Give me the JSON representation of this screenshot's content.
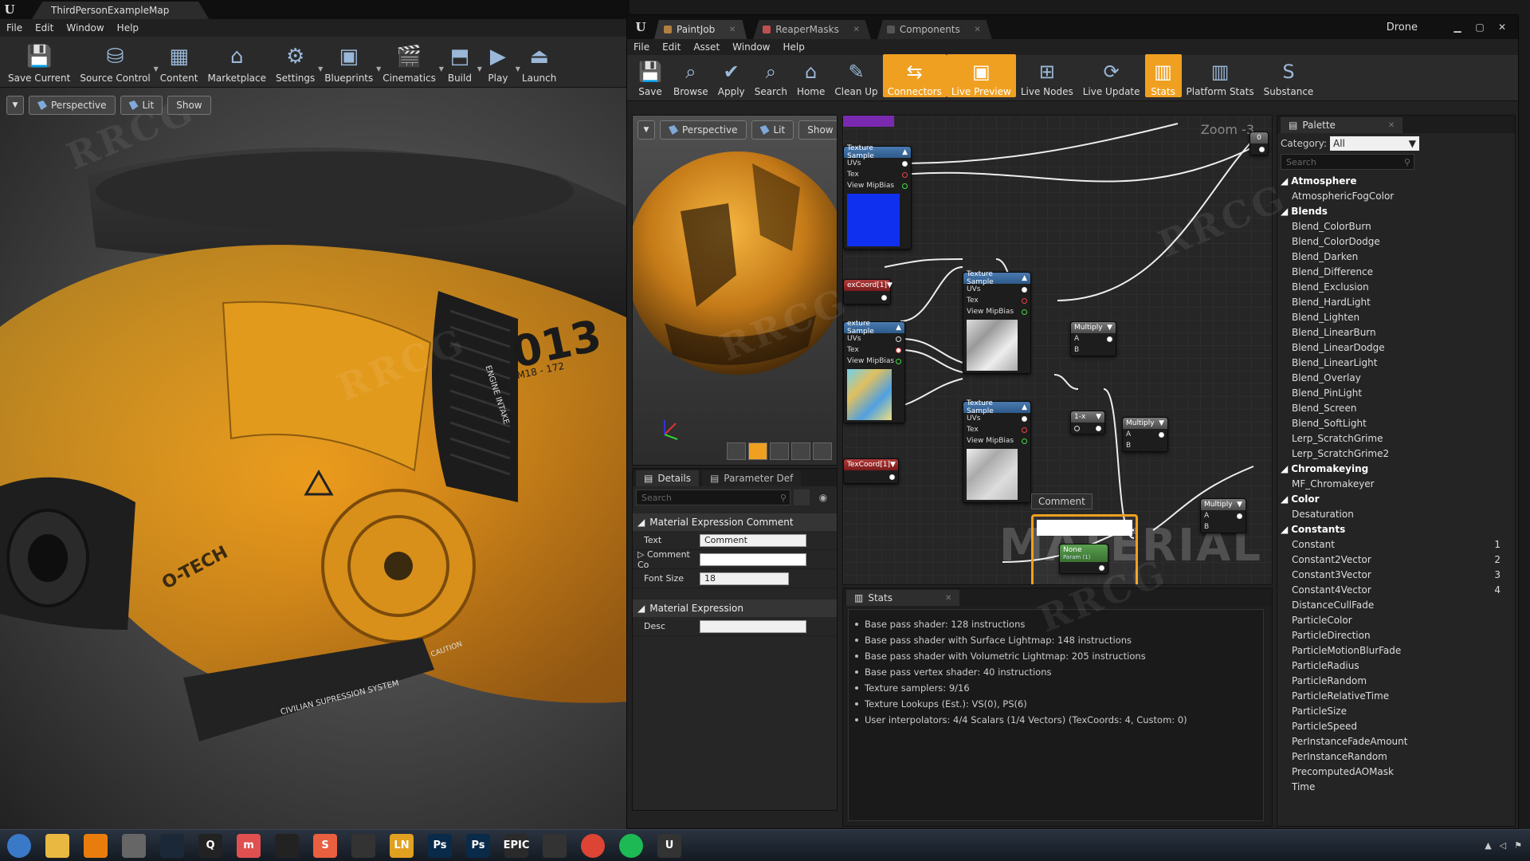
{
  "main_window": {
    "tab_title": "ThirdPersonExampleMap",
    "menu": [
      "File",
      "Edit",
      "Window",
      "Help"
    ],
    "toolbar": [
      {
        "label": "Save Current",
        "icon": "save-icon",
        "drop": false
      },
      {
        "label": "Source Control",
        "icon": "source-control-icon",
        "drop": true
      },
      {
        "label": "Content",
        "icon": "content-icon",
        "drop": false
      },
      {
        "label": "Marketplace",
        "icon": "marketplace-icon",
        "drop": false
      },
      {
        "label": "Settings",
        "icon": "settings-icon",
        "drop": true
      },
      {
        "label": "Blueprints",
        "icon": "blueprints-icon",
        "drop": true
      },
      {
        "label": "Cinematics",
        "icon": "cinematics-icon",
        "drop": true
      },
      {
        "label": "Build",
        "icon": "build-icon",
        "drop": true
      },
      {
        "label": "Play",
        "icon": "play-icon",
        "drop": true
      },
      {
        "label": "Launch",
        "icon": "launch-icon",
        "drop": false
      }
    ],
    "viewport": {
      "perspective": "Perspective",
      "lit": "Lit",
      "show": "Show",
      "decals": {
        "model": "013",
        "model_sub": "M18 - 172",
        "engine": "ENGINE INTAKE",
        "brand": "O-TECH",
        "caution": "CAUTION",
        "system": "CIVILIAN SUPRESSION SYSTEM"
      }
    }
  },
  "material_editor": {
    "tabs": [
      "PaintJob",
      "ReaperMasks",
      "Components"
    ],
    "drone_label": "Drone",
    "menu": [
      "File",
      "Edit",
      "Asset",
      "Window",
      "Help"
    ],
    "toolbar": [
      {
        "label": "Save",
        "icon": "save-icon",
        "active": false
      },
      {
        "label": "Browse",
        "icon": "browse-icon",
        "active": false
      },
      {
        "label": "Apply",
        "icon": "apply-icon",
        "active": false
      },
      {
        "label": "Search",
        "icon": "search-icon",
        "active": false
      },
      {
        "label": "Home",
        "icon": "home-icon",
        "active": false
      },
      {
        "label": "Clean Up",
        "icon": "clean-up-icon",
        "active": false
      },
      {
        "label": "Connectors",
        "icon": "connectors-icon",
        "active": true
      },
      {
        "label": "Live Preview",
        "icon": "live-preview-icon",
        "active": true
      },
      {
        "label": "Live Nodes",
        "icon": "live-nodes-icon",
        "active": false
      },
      {
        "label": "Live Update",
        "icon": "live-update-icon",
        "active": false
      },
      {
        "label": "Stats",
        "icon": "stats-icon",
        "active": true
      },
      {
        "label": "Platform Stats",
        "icon": "platform-stats-icon",
        "active": false
      },
      {
        "label": "Substance",
        "icon": "substance-icon",
        "active": false
      }
    ],
    "preview": {
      "perspective": "Perspective",
      "lit": "Lit",
      "show": "Show"
    },
    "details": {
      "tab_details": "Details",
      "tab_param": "Parameter Def",
      "search_placeholder": "Search",
      "section_comment": "Material Expression Comment",
      "text_label": "Text",
      "text_value": "Comment",
      "comment_color_label": "Comment Co",
      "font_size_label": "Font Size",
      "font_size_value": "18",
      "section_expr": "Material Expression",
      "desc_label": "Desc"
    },
    "graph": {
      "zoom": "Zoom -3",
      "watermark": "MATERIAL",
      "texture_sample": "Texture Sample",
      "texture_sample_clipped": "exture Sample",
      "uvs": "UVs",
      "tex": "Tex",
      "view_mip": "View MipBias",
      "texcoord1": "exCoord[1]",
      "texcoord2": "TexCoord[1]",
      "multiply": "Multiply",
      "one_minus": "1-x",
      "pin_a": "A",
      "pin_b": "B",
      "comment_label": "Comment",
      "param_name": "None",
      "param_sub": "Param (1)",
      "const_value": "0"
    },
    "stats": {
      "tab": "Stats",
      "lines": [
        "Base pass shader: 128 instructions",
        "Base pass shader with Surface Lightmap: 148 instructions",
        "Base pass shader with Volumetric Lightmap: 205 instructions",
        "Base pass vertex shader: 40 instructions",
        "Texture samplers: 9/16",
        "Texture Lookups (Est.): VS(0), PS(6)",
        "User interpolators: 4/4 Scalars (1/4 Vectors) (TexCoords: 4, Custom: 0)"
      ]
    },
    "palette": {
      "tab": "Palette",
      "category_label": "Category:",
      "category_value": "All",
      "search_placeholder": "Search",
      "groups": [
        {
          "name": "Atmosphere",
          "items": [
            {
              "label": "AtmosphericFogColor",
              "key": ""
            }
          ]
        },
        {
          "name": "Blends",
          "items": [
            {
              "label": "Blend_ColorBurn",
              "key": ""
            },
            {
              "label": "Blend_ColorDodge",
              "key": ""
            },
            {
              "label": "Blend_Darken",
              "key": ""
            },
            {
              "label": "Blend_Difference",
              "key": ""
            },
            {
              "label": "Blend_Exclusion",
              "key": ""
            },
            {
              "label": "Blend_HardLight",
              "key": ""
            },
            {
              "label": "Blend_Lighten",
              "key": ""
            },
            {
              "label": "Blend_LinearBurn",
              "key": ""
            },
            {
              "label": "Blend_LinearDodge",
              "key": ""
            },
            {
              "label": "Blend_LinearLight",
              "key": ""
            },
            {
              "label": "Blend_Overlay",
              "key": ""
            },
            {
              "label": "Blend_PinLight",
              "key": ""
            },
            {
              "label": "Blend_Screen",
              "key": ""
            },
            {
              "label": "Blend_SoftLight",
              "key": ""
            },
            {
              "label": "Lerp_ScratchGrime",
              "key": ""
            },
            {
              "label": "Lerp_ScratchGrime2",
              "key": ""
            }
          ]
        },
        {
          "name": "Chromakeying",
          "items": [
            {
              "label": "MF_Chromakeyer",
              "key": ""
            }
          ]
        },
        {
          "name": "Color",
          "items": [
            {
              "label": "Desaturation",
              "key": ""
            }
          ]
        },
        {
          "name": "Constants",
          "items": [
            {
              "label": "Constant",
              "key": "1"
            },
            {
              "label": "Constant2Vector",
              "key": "2"
            },
            {
              "label": "Constant3Vector",
              "key": "3"
            },
            {
              "label": "Constant4Vector",
              "key": "4"
            },
            {
              "label": "DistanceCullFade",
              "key": ""
            },
            {
              "label": "ParticleColor",
              "key": ""
            },
            {
              "label": "ParticleDirection",
              "key": ""
            },
            {
              "label": "ParticleMotionBlurFade",
              "key": ""
            },
            {
              "label": "ParticleRadius",
              "key": ""
            },
            {
              "label": "ParticleRandom",
              "key": ""
            },
            {
              "label": "ParticleRelativeTime",
              "key": ""
            },
            {
              "label": "ParticleSize",
              "key": ""
            },
            {
              "label": "ParticleSpeed",
              "key": ""
            },
            {
              "label": "PerInstanceFadeAmount",
              "key": ""
            },
            {
              "label": "PerInstanceRandom",
              "key": ""
            },
            {
              "label": "PrecomputedAOMask",
              "key": ""
            },
            {
              "label": "Time",
              "key": ""
            }
          ]
        }
      ]
    }
  },
  "taskbar": {
    "items": [
      {
        "name": "start",
        "label": "",
        "color": "#3a78c8"
      },
      {
        "name": "explorer",
        "label": "",
        "color": "#e8b840"
      },
      {
        "name": "blender",
        "label": "",
        "color": "#e87d0d"
      },
      {
        "name": "marmoset",
        "label": "",
        "color": "#666666"
      },
      {
        "name": "steam",
        "label": "",
        "color": "#1b2838"
      },
      {
        "name": "quixel",
        "label": "Q",
        "color": "#222222"
      },
      {
        "name": "marvelous",
        "label": "m",
        "color": "#e05050"
      },
      {
        "name": "substance-designer",
        "label": "",
        "color": "#222222"
      },
      {
        "name": "substance-painter",
        "label": "S",
        "color": "#e86040"
      },
      {
        "name": "quixel-2",
        "label": "",
        "color": "#333333"
      },
      {
        "name": "ln",
        "label": "LN",
        "color": "#e0a020"
      },
      {
        "name": "photoshop-1",
        "label": "Ps",
        "color": "#0a2a4a"
      },
      {
        "name": "photoshop-2",
        "label": "Ps",
        "color": "#0a2a4a"
      },
      {
        "name": "epic-games",
        "label": "EPIC",
        "color": "#2a2a2a"
      },
      {
        "name": "unknown",
        "label": "",
        "color": "#333333"
      },
      {
        "name": "chrome",
        "label": "",
        "color": "#dd4433"
      },
      {
        "name": "spotify",
        "label": "",
        "color": "#1db954"
      },
      {
        "name": "unreal",
        "label": "U",
        "color": "#333333"
      }
    ]
  },
  "colors": {
    "accent": "#f0a020",
    "drone_yellow": "#f2a51a",
    "node_blue": "#3a6aa0"
  }
}
